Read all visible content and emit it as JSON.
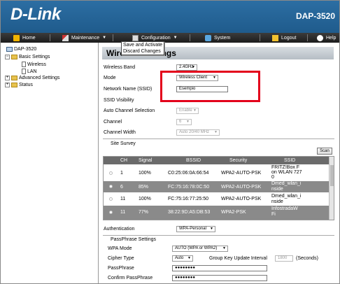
{
  "header": {
    "logo": "D-Link",
    "model": "DAP-3520"
  },
  "menu": {
    "home": "Home",
    "maintenance": "Maintenance",
    "configuration": "Configuration",
    "system": "System",
    "logout": "Logout",
    "help": "Help",
    "config_dropdown": [
      "Save and Activate",
      "Discard Changes"
    ]
  },
  "tree": {
    "root": "DAP-3520",
    "basic": "Basic Settings",
    "wireless": "Wireless",
    "lan": "LAN",
    "advanced": "Advanced Settings",
    "status": "Status"
  },
  "main": {
    "title": "Wireless Settings",
    "fields": {
      "band_label": "Wireless Band",
      "band_value": "2.4GHz",
      "mode_label": "Mode",
      "mode_value": "Wireless Client",
      "ssid_label": "Network Name (SSID)",
      "ssid_value": "Esempio",
      "visibility_label": "SSID Visibility",
      "auto_channel_label": "Auto Channel Selection",
      "auto_channel_value": "Enable",
      "channel_label": "Channel",
      "channel_value": "6",
      "width_label": "Channel Width",
      "width_value": "Auto 20/40 MHz"
    },
    "survey": {
      "label": "Site Survey",
      "scan": "Scan",
      "columns": [
        "CH",
        "Signal",
        "BSSID",
        "Security",
        "SSID"
      ],
      "rows": [
        {
          "ch": "1",
          "signal": "100%",
          "bssid": "C0:25:06:0A:66:54",
          "security": "WPA2-AUTO-PSK",
          "ssid": [
            "FRITZ!Box F",
            "on WLAN 727",
            "0"
          ]
        },
        {
          "ch": "6",
          "signal": "85%",
          "bssid": "FC:75:16:78:0C:50",
          "security": "WPA2-AUTO-PSK",
          "ssid": [
            "Dmed_wlan_i",
            "nside"
          ]
        },
        {
          "ch": "11",
          "signal": "100%",
          "bssid": "FC:75:16:77:25:50",
          "security": "WPA2-AUTO-PSK",
          "ssid": [
            "Dmed_wlan_i",
            "nside"
          ]
        },
        {
          "ch": "11",
          "signal": "77%",
          "bssid": "38:22:9D:A5:DB:53",
          "security": "WPA2-PSK",
          "ssid": [
            "InfostradaW",
            "Fi"
          ]
        }
      ]
    },
    "auth": {
      "label": "Authentication",
      "value": "WPA-Personal"
    },
    "passphrase": {
      "section": "PassPhrase Settings",
      "wpa_mode_label": "WPA Mode",
      "wpa_mode_value": "AUTO (WPA or WPA2)",
      "cipher_label": "Cipher Type",
      "cipher_value": "Auto",
      "gkui_label": "Group Key Update Interval",
      "gkui_value": "1800",
      "gkui_unit": "(Seconds)",
      "pass_label": "PassPhrase",
      "pass_value": "●●●●●●●●",
      "confirm_label": "Confirm PassPhrase",
      "confirm_value": "●●●●●●●●"
    }
  },
  "colors": {
    "header": "#2268a0",
    "menubar": "#2a2a2a",
    "highlight": "#e3001b",
    "selected_row": "#8a8a8a"
  }
}
